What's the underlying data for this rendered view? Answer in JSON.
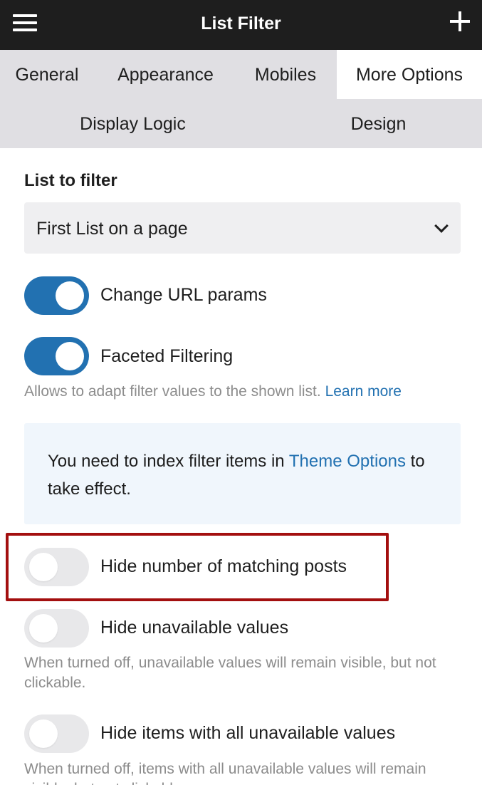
{
  "header": {
    "title": "List Filter",
    "menu_icon": "hamburger-menu-icon",
    "add_icon": "plus-icon"
  },
  "tabs": [
    {
      "label": "General",
      "active": false
    },
    {
      "label": "Appearance",
      "active": false
    },
    {
      "label": "Mobiles",
      "active": false
    },
    {
      "label": "More Options",
      "active": true
    },
    {
      "label": "Display Logic",
      "active": false
    },
    {
      "label": "Design",
      "active": false
    }
  ],
  "list_to_filter": {
    "label": "List to filter",
    "value": "First List on a page"
  },
  "toggles": [
    {
      "label": "Change URL params",
      "on": true
    },
    {
      "label": "Faceted Filtering",
      "on": true,
      "help": "Allows to adapt filter values to the shown list.",
      "help_link": "Learn more"
    },
    {
      "label": "Hide number of matching posts",
      "on": false
    },
    {
      "label": "Hide unavailable values",
      "on": false,
      "help": "When turned off, unavailable values will remain visible, but not clickable."
    },
    {
      "label": "Hide items with all unavailable values",
      "on": false,
      "help": "When turned off, items with all unavailable values will remain visible, but not clickable."
    }
  ],
  "notice": {
    "text_before": "You need to index filter items in",
    "link": "Theme Options",
    "text_after": "to take effect."
  },
  "colors": {
    "header_bg": "#1e1e1e",
    "tab_bg": "#e0dfe3",
    "accent": "#2271b1",
    "highlight": "#a30f0f",
    "notice_bg": "#f0f6fc"
  }
}
